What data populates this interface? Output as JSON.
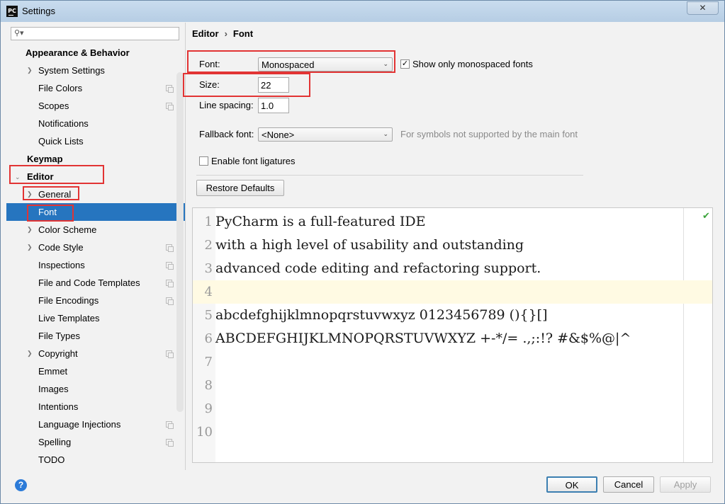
{
  "window": {
    "title": "Settings",
    "icon": "PC",
    "close_glyph": "✕"
  },
  "sidebar": {
    "search_placeholder": "",
    "items": [
      {
        "label": "Appearance & Behavior"
      },
      {
        "label": "System Settings"
      },
      {
        "label": "File Colors"
      },
      {
        "label": "Scopes"
      },
      {
        "label": "Notifications"
      },
      {
        "label": "Quick Lists"
      },
      {
        "label": "Keymap"
      },
      {
        "label": "Editor"
      },
      {
        "label": "General"
      },
      {
        "label": "Font"
      },
      {
        "label": "Color Scheme"
      },
      {
        "label": "Code Style"
      },
      {
        "label": "Inspections"
      },
      {
        "label": "File and Code Templates"
      },
      {
        "label": "File Encodings"
      },
      {
        "label": "Live Templates"
      },
      {
        "label": "File Types"
      },
      {
        "label": "Copyright"
      },
      {
        "label": "Emmet"
      },
      {
        "label": "Images"
      },
      {
        "label": "Intentions"
      },
      {
        "label": "Language Injections"
      },
      {
        "label": "Spelling"
      },
      {
        "label": "TODO"
      }
    ]
  },
  "breadcrumb": {
    "parent": "Editor",
    "separator": "›",
    "current": "Font"
  },
  "form": {
    "font_label": "Font:",
    "font_value": "Monospaced",
    "show_mono_label": "Show only monospaced fonts",
    "show_mono_checked": true,
    "size_label": "Size:",
    "size_value": "22",
    "line_spacing_label": "Line spacing:",
    "line_spacing_value": "1.0",
    "fallback_label": "Fallback font:",
    "fallback_value": "<None>",
    "fallback_hint": "For symbols not supported by the main font",
    "ligatures_label": "Enable font ligatures",
    "ligatures_checked": false,
    "restore_label": "Restore Defaults"
  },
  "preview": {
    "lines": [
      {
        "n": "1",
        "text": "PyCharm is a full-featured IDE"
      },
      {
        "n": "2",
        "text": "with a high level of usability and outstanding"
      },
      {
        "n": "3",
        "text": "advanced code editing and refactoring support."
      },
      {
        "n": "4",
        "text": ""
      },
      {
        "n": "5",
        "text": "abcdefghijklmnopqrstuvwxyz 0123456789 (){}[]"
      },
      {
        "n": "6",
        "text": "ABCDEFGHIJKLMNOPQRSTUVWXYZ +-*/= .,;:!? #&$%@|^"
      },
      {
        "n": "7",
        "text": ""
      },
      {
        "n": "8",
        "text": ""
      },
      {
        "n": "9",
        "text": ""
      },
      {
        "n": "10",
        "text": ""
      }
    ]
  },
  "footer": {
    "help": "?",
    "ok": "OK",
    "cancel": "Cancel",
    "apply": "Apply"
  }
}
